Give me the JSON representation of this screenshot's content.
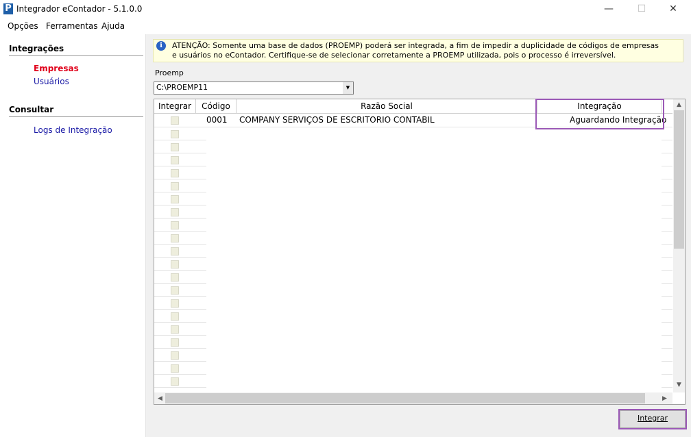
{
  "window": {
    "title": "Integrador eContador - 5.1.0.0",
    "app_icon_letter": "P",
    "minimize": "—",
    "maximize": "☐",
    "close": "✕"
  },
  "menu": {
    "items": [
      "Opções",
      "Ferramentas",
      "Ajuda"
    ]
  },
  "sidebar": {
    "sections": [
      {
        "title": "Integrações",
        "items": [
          {
            "label": "Empresas",
            "active": true
          },
          {
            "label": "Usuários",
            "active": false
          }
        ]
      },
      {
        "title": "Consultar",
        "items": [
          {
            "label": "Logs de Integração",
            "active": false
          }
        ]
      }
    ]
  },
  "alert": {
    "icon": "info-icon",
    "text": "ATENÇÃO: Somente uma base de dados (PROEMP) poderá ser integrada, a fim de impedir a duplicidade de códigos de empresas e usuários no eContador. Certifique-se de selecionar corretamente a PROEMP utilizada, pois o processo é irreversível."
  },
  "proemp": {
    "label": "Proemp",
    "value": "C:\\PROEMP11"
  },
  "grid": {
    "columns": [
      "Integrar",
      "Código",
      "Razão Social",
      "Integração"
    ],
    "rows": [
      {
        "codigo": "0001",
        "razao_social": "COMPANY SERVIÇOS DE ESCRITORIO CONTABIL",
        "integracao": "Aguardando Integração"
      }
    ]
  },
  "actions": {
    "integrar_label": "Integrar"
  },
  "colors": {
    "active_link": "#e0001a",
    "link": "#1a1aa6",
    "highlight": "#9b59b6",
    "alert_bg": "#ffffe1"
  }
}
